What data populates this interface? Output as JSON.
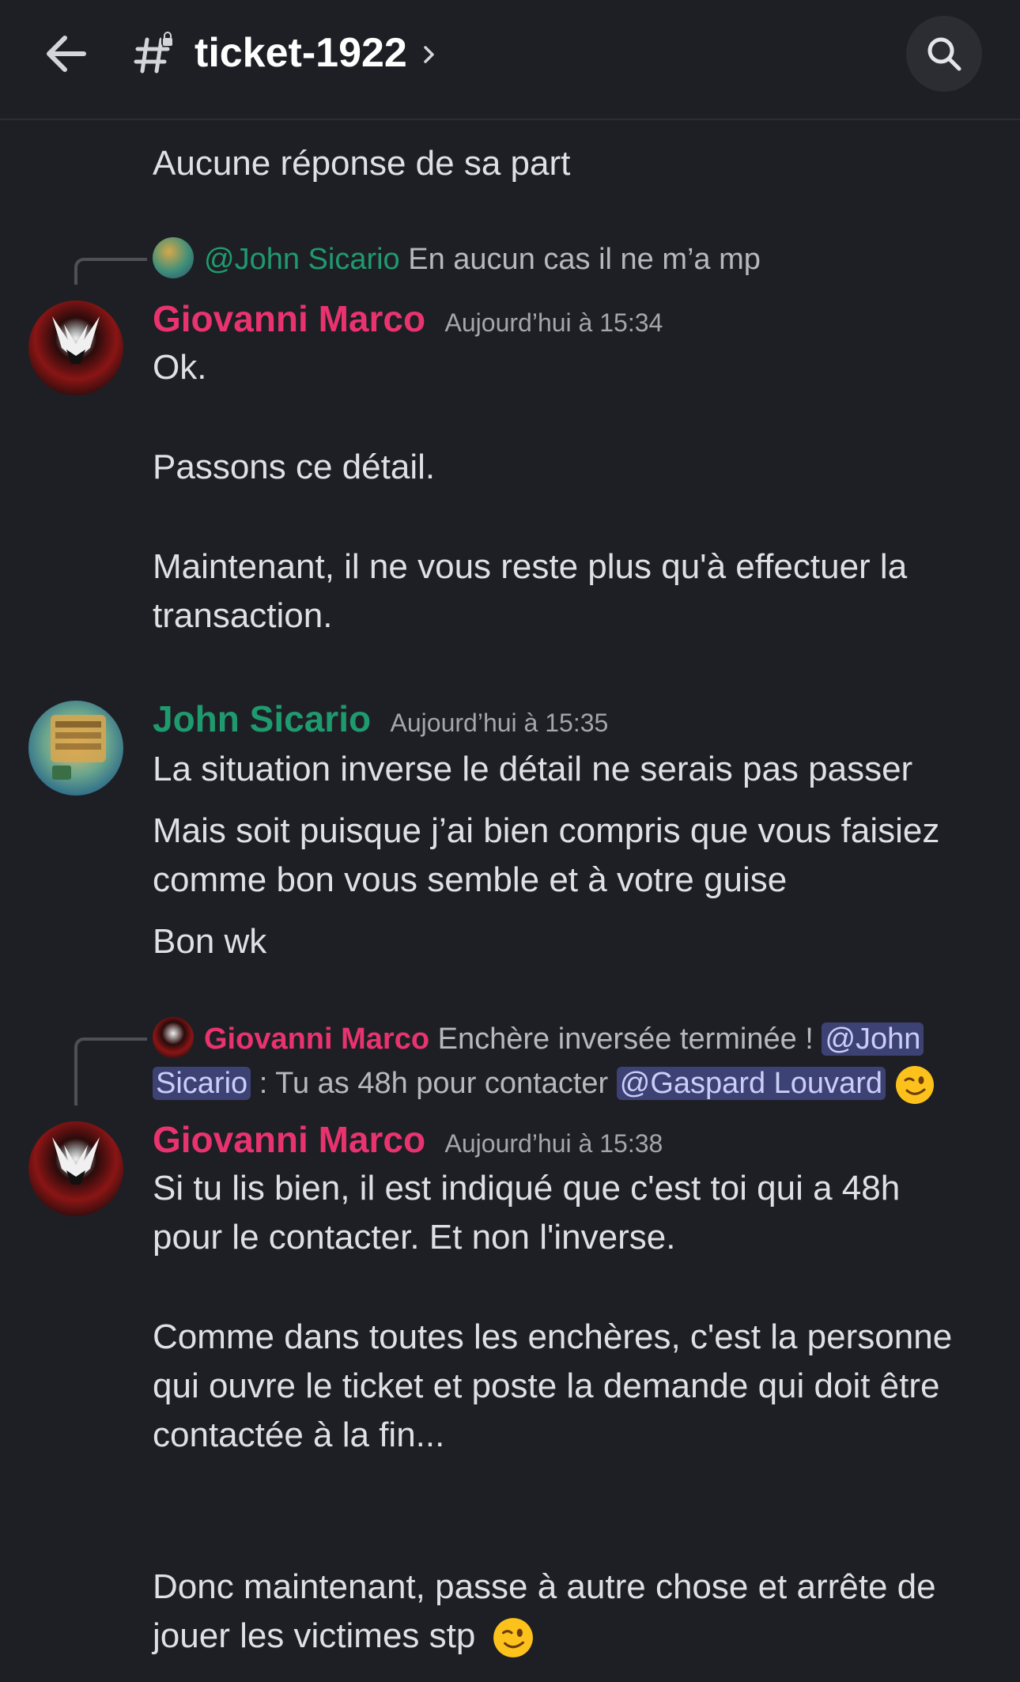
{
  "header": {
    "channel_name": "ticket-1922"
  },
  "messages": {
    "m0": {
      "text": "Aucune réponse de sa part"
    },
    "m1": {
      "reply": {
        "mention": "@John Sicario",
        "preview": "En aucun cas il ne m’a mp"
      },
      "author": "Giovanni Marco",
      "timestamp": "Aujourd’hui à 15:34",
      "lines": [
        "Ok.",
        "Passons ce détail.",
        "Maintenant, il ne vous reste plus qu'à effectuer la",
        "transaction."
      ]
    },
    "m2": {
      "author": "John Sicario",
      "timestamp": "Aujourd’hui à 15:35",
      "lines": [
        "La situation inverse le détail ne serais pas passer",
        "Mais soit puisque j’ai bien compris que vous faisiez",
        "comme bon vous semble et à votre guise",
        "Bon wk"
      ]
    },
    "m3": {
      "reply": {
        "author": "Giovanni Marco",
        "preview_part1": "Enchère inversée terminée !",
        "mention1_part1": "@John",
        "mention1_part2": "Sicario",
        "preview_part2": ": Tu as 48h pour contacter",
        "mention2": "@Gaspard Louvard"
      },
      "author": "Giovanni Marco",
      "timestamp": "Aujourd’hui à 15:38",
      "lines": [
        "Si tu lis bien, il est indiqué que c'est toi qui a 48h",
        "pour le contacter. Et non l'inverse.",
        "Comme dans toutes les enchères, c'est la personne",
        "qui ouvre le ticket et poste la demande qui doit être",
        "contactée à la fin...",
        "Donc maintenant, passe à autre chose et arrête de",
        "jouer les victimes stp"
      ]
    }
  },
  "colors": {
    "background": "#1e1f24",
    "name_red": "#e8336f",
    "name_green": "#1f9a6e",
    "mention_bg": "#3d4274"
  },
  "icons": [
    "back-arrow-icon",
    "hashtag-lock-icon",
    "chevron-right-icon",
    "search-icon",
    "wink-emoji-icon"
  ]
}
